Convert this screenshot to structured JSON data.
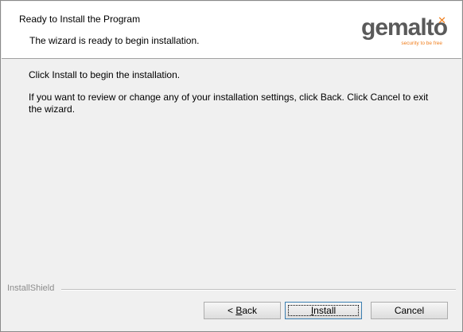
{
  "header": {
    "title": "Ready to Install the Program",
    "subtitle": "The wizard is ready to begin installation.",
    "logo_text": "gemalto",
    "logo_tagline": "security to be free"
  },
  "body": {
    "line1": "Click Install to begin the installation.",
    "line2": "If you want to review or change any of your installation settings, click Back. Click Cancel to exit the wizard."
  },
  "footer": {
    "brand_label": "InstallShield"
  },
  "buttons": {
    "back_prefix": "< ",
    "back_mnemonic": "B",
    "back_rest": "ack",
    "install_mnemonic": "I",
    "install_rest": "nstall",
    "cancel": "Cancel"
  },
  "colors": {
    "logo_gray": "#5a5a5a",
    "logo_accent": "#f07f1e"
  }
}
